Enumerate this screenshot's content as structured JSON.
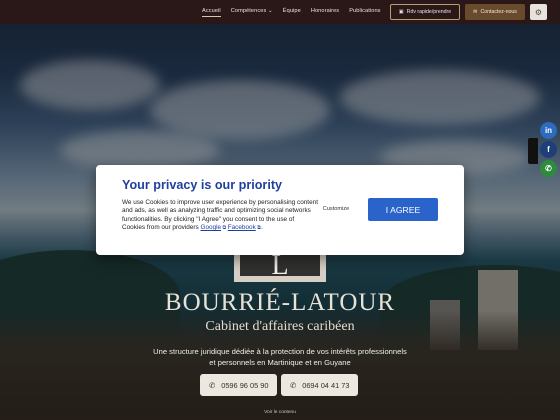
{
  "nav": {
    "items": [
      {
        "label": "Accueil",
        "active": true
      },
      {
        "label": "Compétences ⌄",
        "active": false
      },
      {
        "label": "Équipe",
        "active": false
      },
      {
        "label": "Honoraires",
        "active": false
      },
      {
        "label": "Publications",
        "active": false
      }
    ],
    "appointment_label": "Rdv rapide/prendre",
    "contact_label": "Contactez-nous",
    "settings_icon": "gear-icon"
  },
  "social": [
    {
      "icon": "linkedin-icon",
      "glyph": "in",
      "color": "#2d6bbf"
    },
    {
      "icon": "facebook-icon",
      "glyph": "f",
      "color": "#1e3f7a"
    },
    {
      "icon": "whatsapp-icon",
      "glyph": "✆",
      "color": "#2e8b3e"
    }
  ],
  "brand": {
    "logo_letter": "L",
    "name": "BOURRIÉ-LATOUR",
    "subtitle": "Cabinet d'affaires caribéen",
    "tagline": "Une structure juridique dédiée à la protection de vos intérêts professionnels et personnels en Martinique et en Guyane",
    "phone_1": "0596 96 05 90",
    "phone_2": "0694 04 41 73",
    "scroll_hint": "Voir le contenu"
  },
  "cookie_modal": {
    "title": "Your privacy is our priority",
    "body_text": "We use Cookies to improve user experience by personalising content and ads, as well as analyzing traffic and optimizing social networks functionalities. By clicking \"I Agree\" you consent to the use of Cookies from our providers",
    "link_google": "Google",
    "link_facebook": "Facebook",
    "customize_label": "Customize",
    "agree_label": "I AGREE"
  },
  "colors": {
    "accent_blue": "#2a63c9",
    "title_blue": "#1f3fa0",
    "topbar_bg": "#2a1717",
    "brand_brown": "#6a4a2c"
  }
}
